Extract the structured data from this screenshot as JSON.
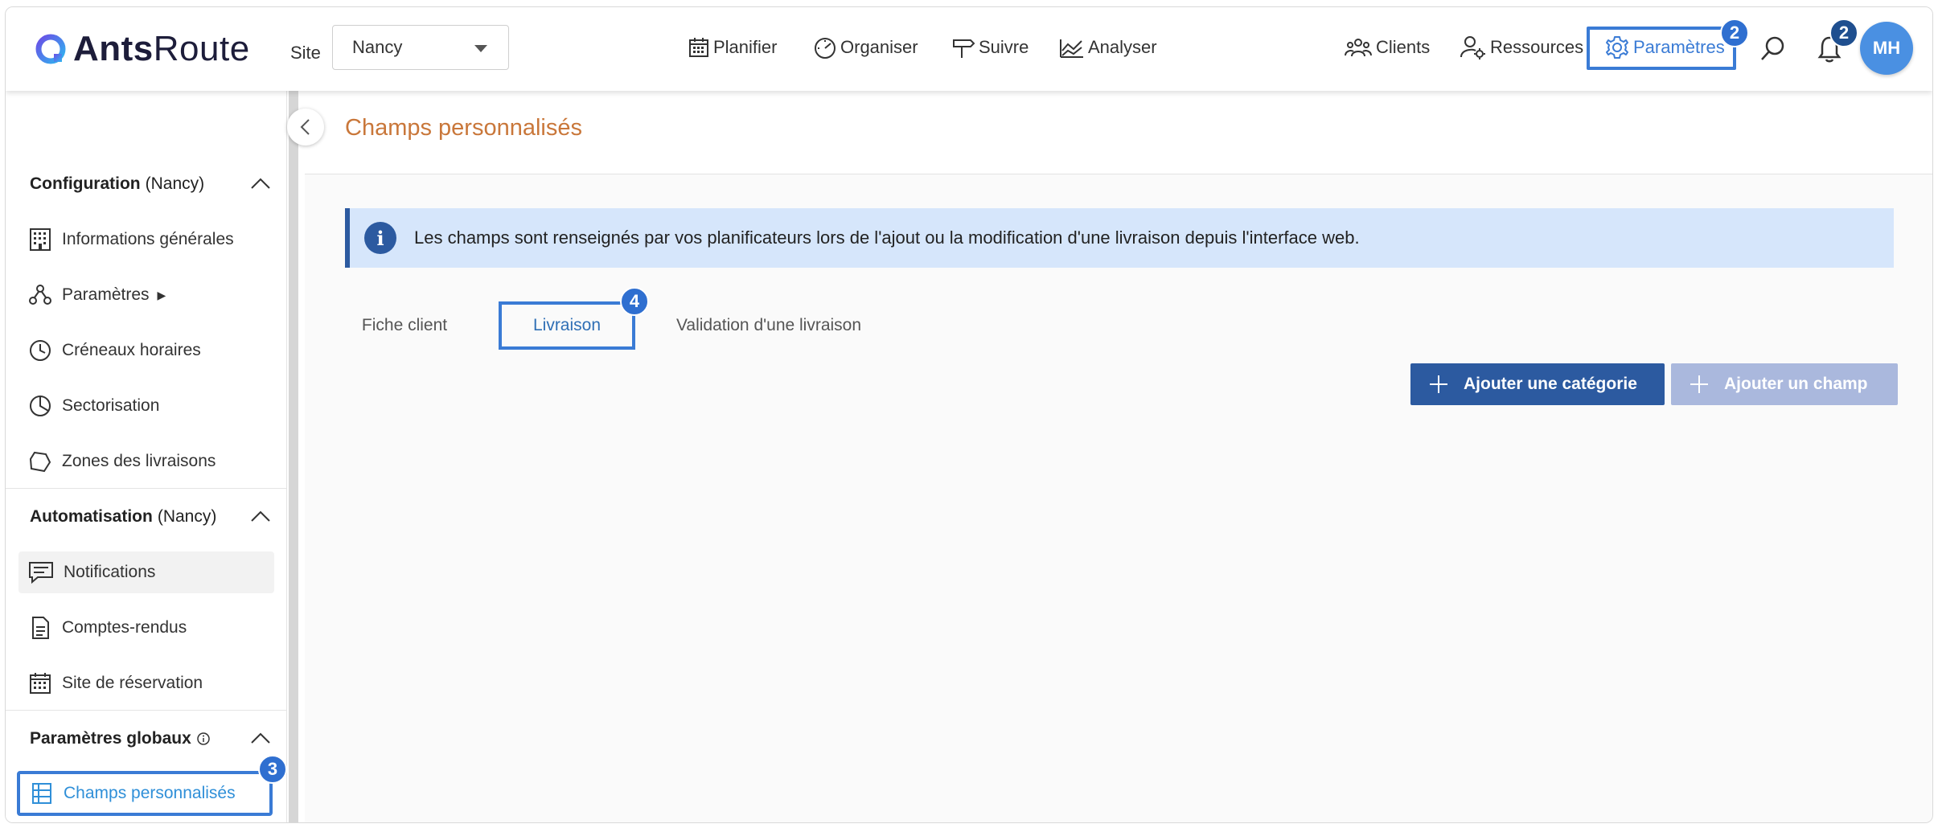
{
  "header": {
    "logo_prefix": "Ants",
    "logo_suffix": "Route",
    "site_label": "Site",
    "site_value": "Nancy",
    "nav": [
      {
        "label": "Planifier",
        "icon": "calendar-icon"
      },
      {
        "label": "Organiser",
        "icon": "gauge-icon"
      },
      {
        "label": "Suivre",
        "icon": "signpost-icon"
      },
      {
        "label": "Analyser",
        "icon": "chart-icon"
      }
    ],
    "right_nav": [
      {
        "label": "Clients",
        "icon": "people-icon"
      },
      {
        "label": "Ressources",
        "icon": "user-gear-icon"
      },
      {
        "label": "Paramètres",
        "icon": "gear-icon"
      }
    ],
    "params_step": "2",
    "notif_count": "2",
    "avatar_initials": "MH",
    "accent_color": "#3a7bd5"
  },
  "sidebar": {
    "configuration": {
      "title": "Configuration",
      "site": "(Nancy)"
    },
    "config_items": [
      {
        "label": "Informations générales",
        "icon": "building-icon"
      },
      {
        "label": "Paramètres",
        "icon": "nodes-icon",
        "arrow": "▶"
      },
      {
        "label": "Créneaux horaires",
        "icon": "clock-icon"
      },
      {
        "label": "Sectorisation",
        "icon": "pie-icon"
      },
      {
        "label": "Zones des livraisons",
        "icon": "polygon-icon"
      }
    ],
    "automatisation": {
      "title": "Automatisation",
      "site": "(Nancy)"
    },
    "auto_items": [
      {
        "label": "Notifications",
        "icon": "message-icon"
      },
      {
        "label": "Comptes-rendus",
        "icon": "document-icon"
      },
      {
        "label": "Site de réservation",
        "icon": "calendar-icon"
      }
    ],
    "global": {
      "title": "Paramètres globaux"
    },
    "global_items": [
      {
        "label": "Champs personnalisés",
        "icon": "table-icon",
        "step": "3"
      }
    ]
  },
  "main": {
    "title": "Champs personnalisés",
    "info": "Les champs sont renseignés par vos planificateurs lors de l'ajout ou la modification d'une livraison depuis l'interface web.",
    "tabs": [
      {
        "label": "Fiche client"
      },
      {
        "label": "Livraison",
        "step": "4"
      },
      {
        "label": "Validation d'une livraison"
      }
    ],
    "add_category": "Ajouter une catégorie",
    "add_field": "Ajouter un champ"
  }
}
